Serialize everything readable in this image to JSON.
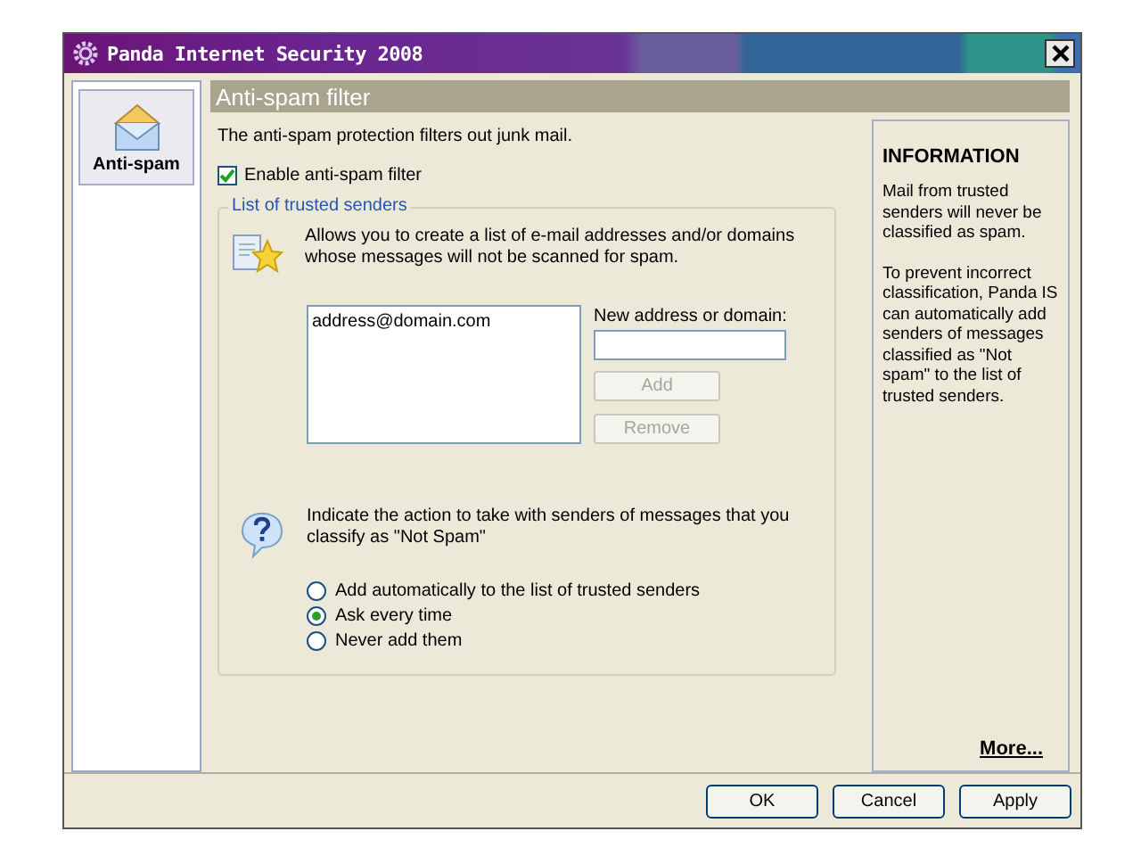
{
  "window": {
    "title": "Panda Internet Security 2008"
  },
  "sidebar": {
    "items": [
      {
        "label": "Anti-spam",
        "selected": true
      }
    ]
  },
  "panel": {
    "title": "Anti-spam filter",
    "description": "The anti-spam protection filters out junk mail.",
    "enable": {
      "label": "Enable anti-spam filter",
      "checked": true
    },
    "trusted": {
      "legend": "List of trusted senders",
      "description": "Allows you to create a list of e-mail addresses and/or domains whose messages will not be scanned for spam.",
      "addresses": [
        {
          "text": "address@domain.com",
          "selected": false
        }
      ],
      "new_label": "New address or domain:",
      "buttons": [
        {
          "label": "Add",
          "disabled": true
        },
        {
          "label": "Remove",
          "disabled": true
        }
      ]
    },
    "action": {
      "prompt": "Indicate the action to take with senders of messages that you classify as \"Not Spam\"",
      "options": [
        {
          "label": "Add automatically to the list of trusted senders",
          "selected": false
        },
        {
          "label": "Ask every time",
          "selected": true
        },
        {
          "label": "Never add them",
          "selected": false
        }
      ]
    }
  },
  "info": {
    "title": "INFORMATION",
    "paragraphs": [
      "Mail from trusted senders will never be classified as spam.",
      "To prevent incorrect classification, Panda IS can automatically add senders of messages classified as \"Not spam\" to the list of trusted senders."
    ],
    "link": "More..."
  },
  "buttons": [
    "OK",
    "Cancel",
    "Apply"
  ]
}
